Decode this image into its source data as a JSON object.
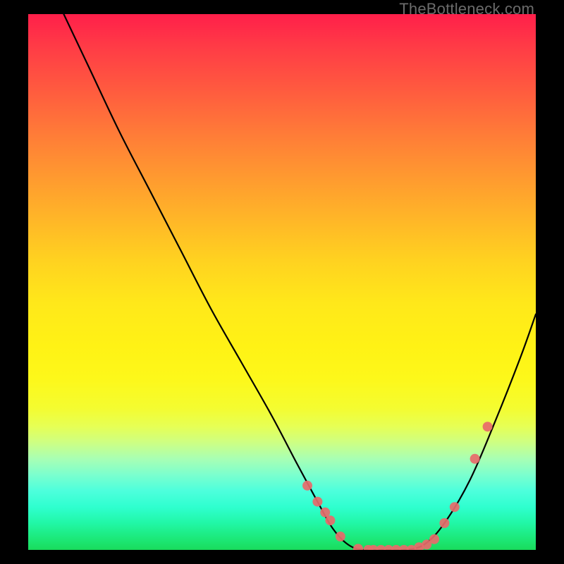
{
  "attribution": "TheBottleneck.com",
  "colors": {
    "page_bg": "#000000",
    "curve": "#000000",
    "point": "#e86a6a",
    "gradient_top": "#ff1f4a",
    "gradient_mid": "#ffe81a",
    "gradient_bottom": "#1adb5c"
  },
  "chart_data": {
    "type": "line",
    "title": "",
    "xlabel": "",
    "ylabel": "",
    "xlim": [
      0,
      100
    ],
    "ylim": [
      0,
      100
    ],
    "grid": false,
    "legend": false,
    "series": [
      {
        "name": "bottleneck-curve",
        "x": [
          7,
          12,
          18,
          24,
          30,
          36,
          42,
          48,
          53,
          57,
          60,
          63,
          66,
          70,
          74,
          78,
          82,
          87,
          92,
          97,
          100
        ],
        "y": [
          100,
          90,
          78,
          67,
          56,
          45,
          35,
          25,
          16,
          9,
          4,
          1,
          0,
          0,
          0,
          1,
          5,
          13,
          24,
          36,
          44
        ]
      }
    ],
    "highlight_points": {
      "name": "marked-points",
      "x": [
        55,
        57,
        58.5,
        59.5,
        61.5,
        65,
        67,
        68,
        69.5,
        71,
        72.5,
        74,
        75.5,
        77,
        78.5,
        80,
        82,
        84,
        88,
        90.5
      ],
      "y": [
        12,
        9,
        7,
        5.5,
        2.5,
        0.2,
        0,
        0,
        0,
        0,
        0,
        0,
        0,
        0.5,
        1,
        2,
        5,
        8,
        17,
        23
      ]
    }
  }
}
